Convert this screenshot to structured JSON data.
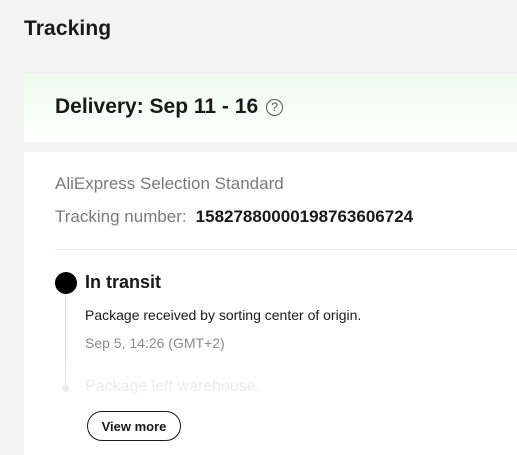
{
  "page": {
    "title": "Tracking"
  },
  "delivery": {
    "label": "Delivery: Sep 11 - 16",
    "help_icon": "question-circle-icon",
    "help_glyph": "?"
  },
  "shipment": {
    "carrier": "AliExpress Selection Standard",
    "tracking_label": "Tracking number:",
    "tracking_number": "15827880000198763606724"
  },
  "timeline": {
    "status": "In transit",
    "events": [
      {
        "description": "Package received by sorting center of origin.",
        "time": "Sep 5, 14:26 (GMT+2)"
      },
      {
        "description": "Package left warehouse."
      }
    ],
    "view_more_label": "View more"
  },
  "colors": {
    "background": "#f3f3f3",
    "card": "#ffffff",
    "delivery_tint": "#eefbee",
    "primary_text": "#191919",
    "secondary_text": "#7a7a7a",
    "timeline_dot": "#000000"
  }
}
